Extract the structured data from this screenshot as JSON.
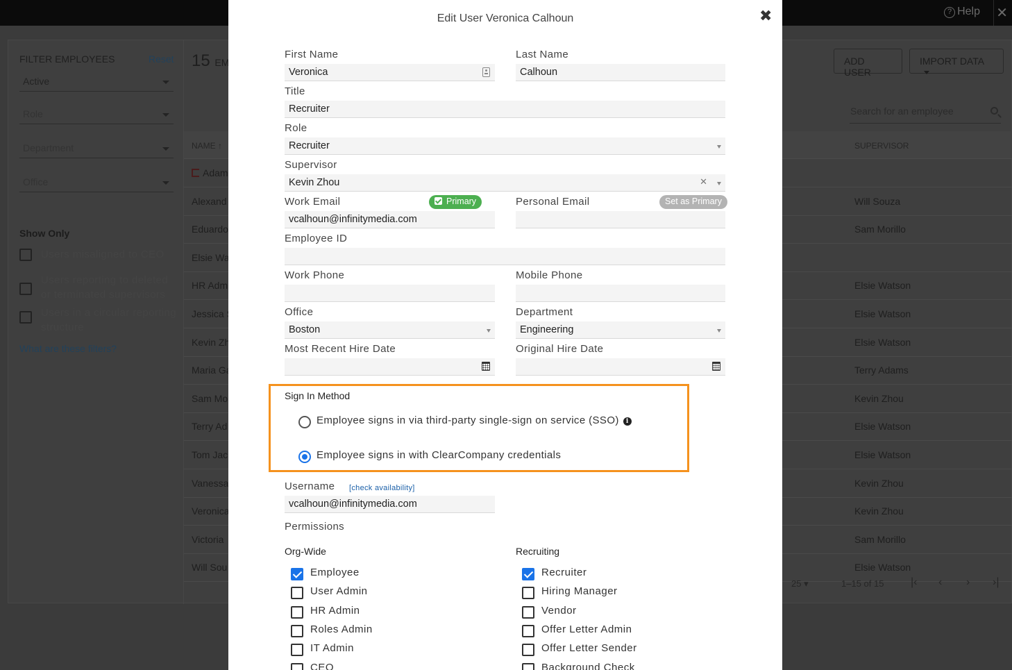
{
  "topbar": {
    "help": "Help"
  },
  "filters": {
    "title": "FILTER EMPLOYEES",
    "reset": "Reset",
    "status": "Active",
    "role": "Role",
    "department": "Department",
    "office": "Office",
    "show_only": "Show Only",
    "checks": [
      "Users misaligned to CEO",
      "Users reporting to deleted or terminated supervisors",
      "Users in a circular reporting structure"
    ],
    "help_link": "What are these filters?"
  },
  "list": {
    "count": "15",
    "count_suffix": "EM",
    "add_user": "ADD USER",
    "import_data": "IMPORT DATA",
    "search_placeholder": "Search for an employee",
    "col_name": "NAME",
    "col_supervisor": "SUPERVISOR",
    "rows": [
      {
        "name": "Adam",
        "supervisor": ""
      },
      {
        "name": "Alexand",
        "supervisor": "Will Souza"
      },
      {
        "name": "Eduardo",
        "supervisor": "Sam Morillo"
      },
      {
        "name": "Elsie Wa",
        "supervisor": ""
      },
      {
        "name": "HR Adm",
        "supervisor": "Elsie Watson"
      },
      {
        "name": "Jessica S",
        "supervisor": "Elsie Watson"
      },
      {
        "name": "Kevin Zh",
        "supervisor": "Elsie Watson"
      },
      {
        "name": "Maria Ga",
        "supervisor": "Terry Adams"
      },
      {
        "name": "Sam Mo",
        "supervisor": "Kevin Zhou"
      },
      {
        "name": "Terry Ad",
        "supervisor": "Elsie Watson"
      },
      {
        "name": "Tom Jack",
        "supervisor": "Elsie Watson"
      },
      {
        "name": "Vanessa",
        "supervisor": "Kevin Zhou"
      },
      {
        "name": "Veronica",
        "supervisor": "Kevin Zhou"
      },
      {
        "name": "Victoria",
        "supervisor": "Sam Morillo"
      },
      {
        "name": "Will Sou",
        "supervisor": "Elsie Watson"
      }
    ],
    "per_page": "25",
    "range": "1–15 of 15"
  },
  "modal": {
    "title": "Edit User Veronica Calhoun",
    "first_name_label": "First Name",
    "first_name": "Veronica",
    "last_name_label": "Last Name",
    "last_name": "Calhoun",
    "title_label": "Title",
    "title_value": "Recruiter",
    "role_label": "Role",
    "role": "Recruiter",
    "supervisor_label": "Supervisor",
    "supervisor": "Kevin Zhou",
    "work_email_label": "Work Email",
    "primary_badge": "Primary",
    "work_email": "vcalhoun@infinitymedia.com",
    "personal_email_label": "Personal Email",
    "set_primary": "Set as Primary",
    "personal_email": "",
    "employee_id_label": "Employee ID",
    "employee_id": "",
    "work_phone_label": "Work Phone",
    "work_phone": "",
    "mobile_phone_label": "Mobile Phone",
    "mobile_phone": "",
    "office_label": "Office",
    "office": "Boston",
    "department_label": "Department",
    "department": "Engineering",
    "recent_hire_label": "Most Recent Hire Date",
    "recent_hire": "",
    "original_hire_label": "Original Hire Date",
    "original_hire": "",
    "sign_in_label": "Sign In Method",
    "sso_option": "Employee signs in via third-party single-sign on service (SSO)",
    "cc_option": "Employee signs in with ClearCompany credentials",
    "selected_sign_in": "cc",
    "username_label": "Username",
    "check_availability": "[check availability]",
    "username": "vcalhoun@infinitymedia.com",
    "permissions_label": "Permissions",
    "org_wide_label": "Org-Wide",
    "org_wide": [
      {
        "label": "Employee",
        "checked": true
      },
      {
        "label": "User Admin",
        "checked": false
      },
      {
        "label": "HR Admin",
        "checked": false
      },
      {
        "label": "Roles Admin",
        "checked": false
      },
      {
        "label": "IT Admin",
        "checked": false
      },
      {
        "label": "CEO",
        "checked": false
      }
    ],
    "recruiting_label": "Recruiting",
    "recruiting": [
      {
        "label": "Recruiter",
        "checked": true
      },
      {
        "label": "Hiring Manager",
        "checked": false
      },
      {
        "label": "Vendor",
        "checked": false
      },
      {
        "label": "Offer Letter Admin",
        "checked": false
      },
      {
        "label": "Offer Letter Sender",
        "checked": false
      },
      {
        "label": "Background Check",
        "checked": false
      }
    ]
  }
}
